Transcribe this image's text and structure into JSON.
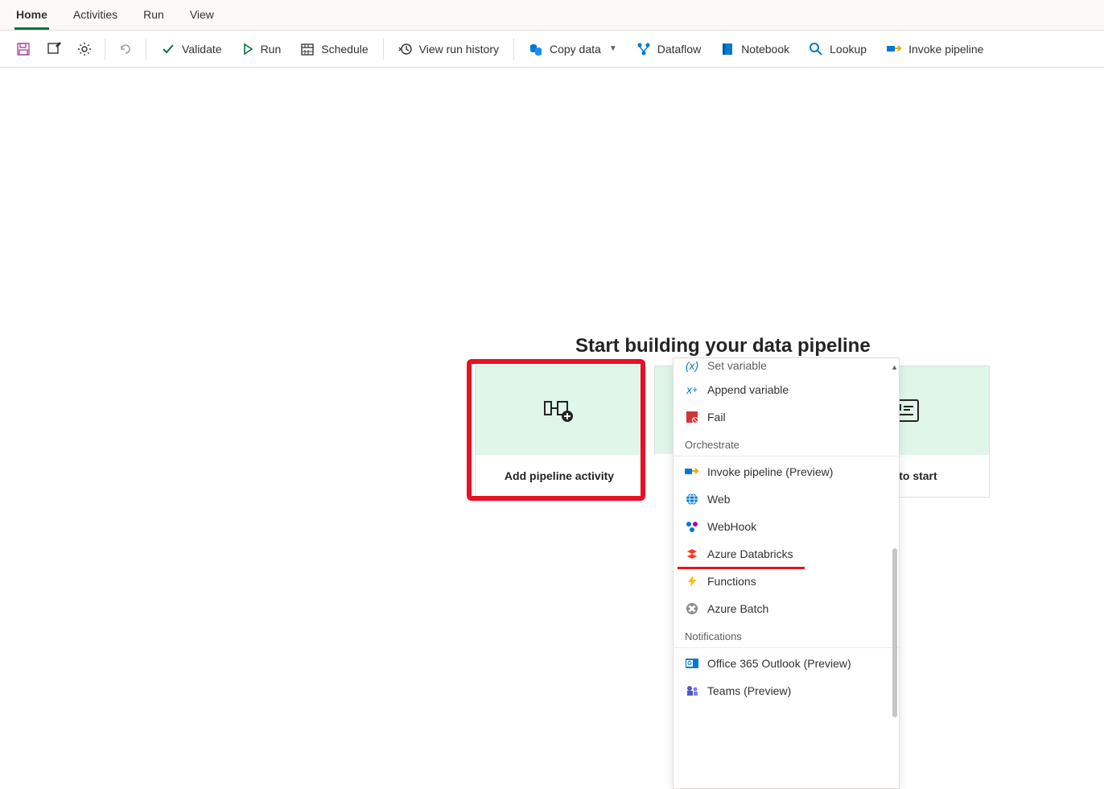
{
  "tabs": {
    "items": [
      "Home",
      "Activities",
      "Run",
      "View"
    ],
    "active": 0
  },
  "toolbar": {
    "validate": "Validate",
    "run": "Run",
    "schedule": "Schedule",
    "view_run_history": "View run history",
    "copy_data": "Copy data",
    "dataflow": "Dataflow",
    "notebook": "Notebook",
    "lookup": "Lookup",
    "invoke_pipeline": "Invoke pipeline"
  },
  "canvas": {
    "heading": "Start building your data pipeline",
    "card1_label": "Add pipeline activity",
    "card3_label": "task to start"
  },
  "dropdown": {
    "cut_item": "Set variable",
    "top_items": [
      {
        "label": "Append variable"
      },
      {
        "label": "Fail"
      }
    ],
    "group_orchestrate": "Orchestrate",
    "orchestrate_items": [
      {
        "label": "Invoke pipeline (Preview)"
      },
      {
        "label": "Web"
      },
      {
        "label": "WebHook"
      },
      {
        "label": "Azure Databricks"
      },
      {
        "label": "Functions"
      },
      {
        "label": "Azure Batch"
      }
    ],
    "group_notifications": "Notifications",
    "notifications_items": [
      {
        "label": "Office 365 Outlook (Preview)"
      },
      {
        "label": "Teams (Preview)"
      }
    ]
  }
}
